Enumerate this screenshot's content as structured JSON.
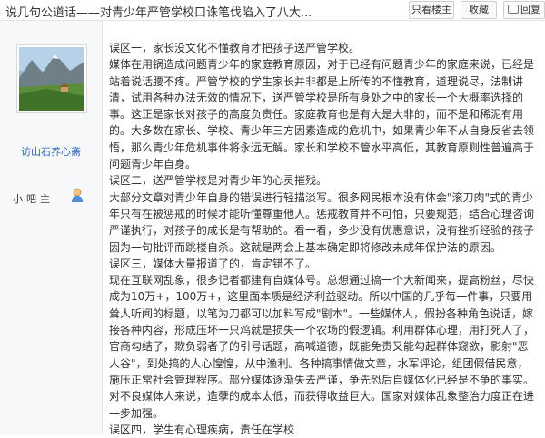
{
  "header": {
    "title": "说几句公道话——对青少年严管学校口诛笔伐陷入了八大...",
    "btn_only_lz": "只看楼主",
    "btn_favorite": "收藏",
    "btn_reply": "回复"
  },
  "sidebar": {
    "badge": "楼主",
    "username": "访山石养心斋",
    "role_label": "小吧主",
    "accent": "#2d64b3"
  },
  "post": {
    "paragraphs": [
      "误区一，家长没文化不懂教育才把孩子送严管学校。",
      "媒体在用锅造成问题青少年的家庭教育原因，对于已经有问题青少年的家庭来说，已经是站着说话腰不疼。严管学校的学生家长并非都是上所传的不懂教育，道理说尽，法制讲清，试用各种办法无效的情况下，送严管学校是所有身处之中的家长一个大概率选择的事。这正是家长对孩子的高度负责任。家庭教育也是有大是大非的，而不是和稀泥有用的。大多数在家长、学校、青少年三方因素造成的危机中，如果青少年不从自身反省去领悟，那么青少年危机事件将永远无解。家长和学校不管水平高低，其教育原则性普遍高于问题青少年自身。",
      "误区二，送严管学校是对青少年的心灵摧残。",
      "大部分文章对青少年自身的错误进行轻描淡写。很多网民根本没有体会\"滚刀肉\"式的青少年只有在被惩戒的时候才能听懂尊重他人。惩戒教育并不可怕，只要规范，结合心理咨询严谨执行，对孩子的成长是有帮助的。看一看，多少没有优惠意识，没有挫折经验的孩子因为一句批评而跳楼自杀。这就是两会上基本确定即将修改未成年保护法的原因。",
      "误区三，媒体大量报道了的，肯定错不了。",
      "现在互联网乱象，很多记者都建有自媒体号。总想通过搞一个大新闻来，提高粉丝，尽快成为10万+，100万+，这里面本质是经济利益驱动。所以中国的几乎每一件事，只要用耸人听闻的标题，以笔为刀都可以加料写成\"剧本\"。一些媒体人，假扮各种角色说话，嫁接各种内容，形成压坏一只鸡就是损失一个农场的假逻辑。利用群体心理，用打死人了，官商勾结了，欺负弱者了的引号话题，高喊道德，既能免责又能勾起群体窥欲，影射\"恶人谷\"，到处搞的人心惶惶，从中渔利。各种搞事情做文章，水军评论，组团假借民意，施压正常社会管理程序。部分媒体逐渐失去严谨，争先恐后自媒体化已经是不争的事实。对不良媒体人来说，造孽的成本太低，而获得收益巨大。国家对媒体乱象整治力度正在进一步加强。",
      "误区四，学生有心理疾病，责任在学校"
    ]
  }
}
